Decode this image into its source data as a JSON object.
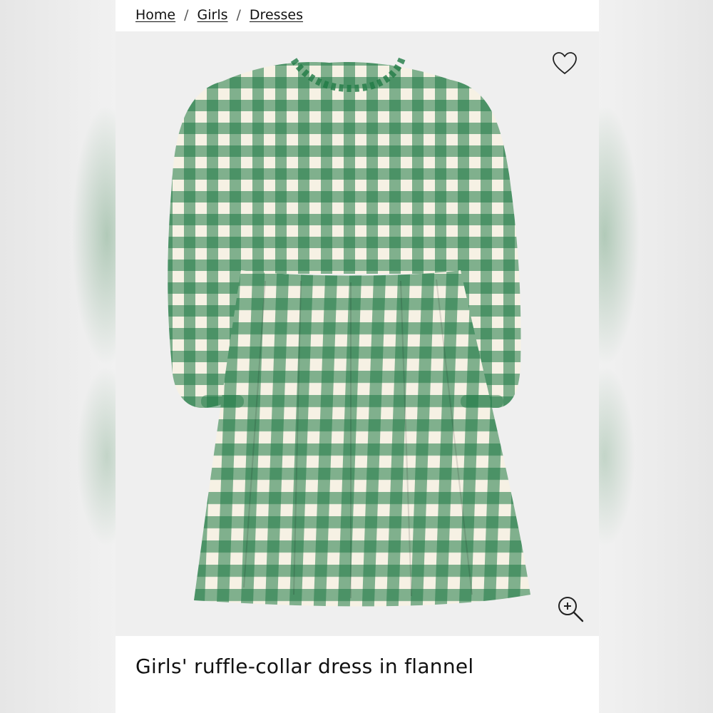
{
  "breadcrumb": {
    "items": [
      "Home",
      "Girls",
      "Dresses"
    ],
    "separator": "/"
  },
  "product": {
    "title": "Girls' ruffle-collar dress in flannel",
    "image_description_colors": {
      "gingham_green": "#1f7a45",
      "gingham_cream": "#f6f1e4"
    }
  },
  "icons": {
    "favorite": "heart-icon",
    "zoom": "zoom-in-icon"
  }
}
